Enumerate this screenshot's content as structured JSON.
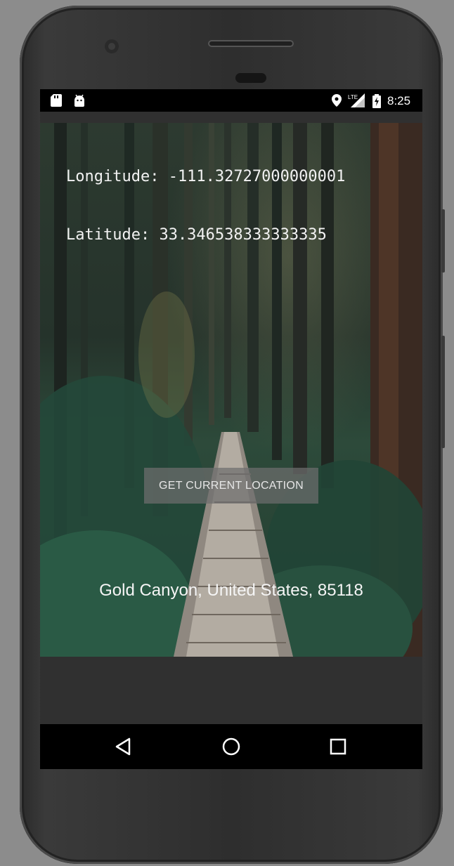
{
  "status_bar": {
    "time": "8:25",
    "icons": [
      "sd-card-icon",
      "android-icon",
      "location-icon",
      "lte-signal-icon",
      "battery-charging-icon"
    ],
    "network_label": "LTE"
  },
  "app": {
    "longitude_text": "Longitude: -111.32727000000001",
    "latitude_text": "Latitude: 33.346538333333335",
    "get_location_button": "GET CURRENT LOCATION",
    "address_text": "Gold Canyon, United States, 85118"
  },
  "nav_bar": {
    "buttons": [
      "back-icon",
      "home-icon",
      "recent-apps-icon"
    ]
  },
  "colors": {
    "frame": "#2e2e2e",
    "screen_bg": "#303030",
    "status_bar": "#000000",
    "button_bg": "#6e6e6e"
  }
}
